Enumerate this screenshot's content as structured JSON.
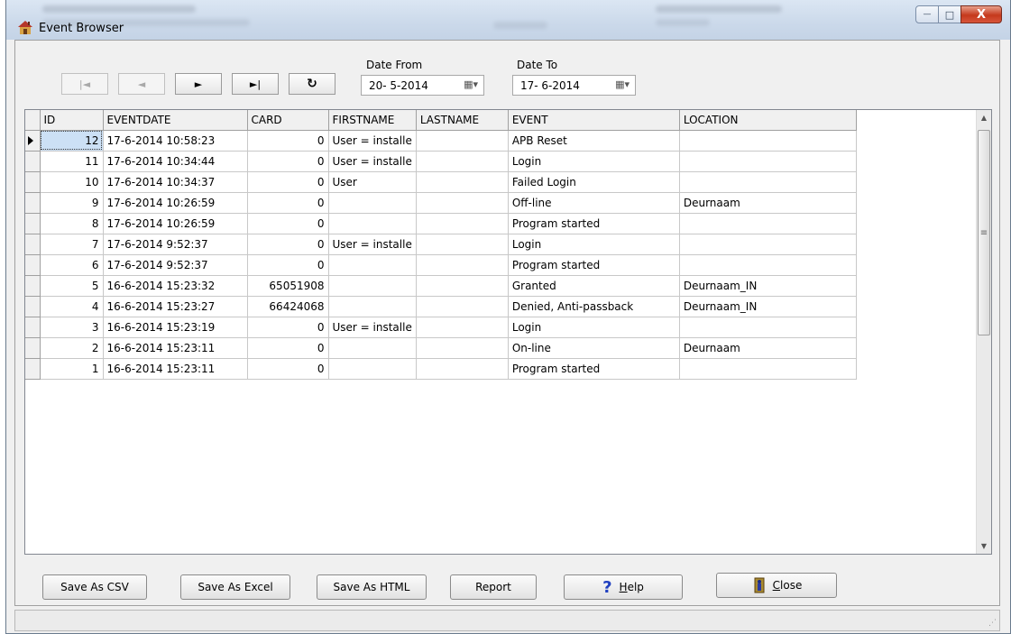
{
  "window": {
    "title": "Event Browser",
    "controls": {
      "minimize": "—",
      "maximize": "□",
      "close": "X"
    }
  },
  "toolbar": {
    "first": "|◄",
    "prior": "◄",
    "next": "►",
    "last": "►|",
    "refresh": "↻",
    "date_from_label": "Date From",
    "date_from_value": "20- 5-2014",
    "date_to_label": "Date To",
    "date_to_value": "17- 6-2014"
  },
  "grid": {
    "columns": [
      "ID",
      "EVENTDATE",
      "CARD",
      "FIRSTNAME",
      "LASTNAME",
      "EVENT",
      "LOCATION"
    ],
    "rows": [
      {
        "id": "12",
        "eventdate": "17-6-2014 10:58:23",
        "card": "0",
        "firstname": "User = installe",
        "lastname": "",
        "event": "APB Reset",
        "location": ""
      },
      {
        "id": "11",
        "eventdate": "17-6-2014 10:34:44",
        "card": "0",
        "firstname": "User = installe",
        "lastname": "",
        "event": "Login",
        "location": ""
      },
      {
        "id": "10",
        "eventdate": "17-6-2014 10:34:37",
        "card": "0",
        "firstname": "User",
        "lastname": "",
        "event": "Failed Login",
        "location": ""
      },
      {
        "id": "9",
        "eventdate": "17-6-2014 10:26:59",
        "card": "0",
        "firstname": "",
        "lastname": "",
        "event": "Off-line",
        "location": "Deurnaam"
      },
      {
        "id": "8",
        "eventdate": "17-6-2014 10:26:59",
        "card": "0",
        "firstname": "",
        "lastname": "",
        "event": "Program started",
        "location": ""
      },
      {
        "id": "7",
        "eventdate": "17-6-2014 9:52:37",
        "card": "0",
        "firstname": "User = installe",
        "lastname": "",
        "event": "Login",
        "location": ""
      },
      {
        "id": "6",
        "eventdate": "17-6-2014 9:52:37",
        "card": "0",
        "firstname": "",
        "lastname": "",
        "event": "Program started",
        "location": ""
      },
      {
        "id": "5",
        "eventdate": "16-6-2014 15:23:32",
        "card": "65051908",
        "firstname": "",
        "lastname": "",
        "event": "Granted",
        "location": "Deurnaam_IN"
      },
      {
        "id": "4",
        "eventdate": "16-6-2014 15:23:27",
        "card": "66424068",
        "firstname": "",
        "lastname": "",
        "event": "Denied, Anti-passback",
        "location": "Deurnaam_IN"
      },
      {
        "id": "3",
        "eventdate": "16-6-2014 15:23:19",
        "card": "0",
        "firstname": "User = installe",
        "lastname": "",
        "event": "Login",
        "location": ""
      },
      {
        "id": "2",
        "eventdate": "16-6-2014 15:23:11",
        "card": "0",
        "firstname": "",
        "lastname": "",
        "event": "On-line",
        "location": "Deurnaam"
      },
      {
        "id": "1",
        "eventdate": "16-6-2014 15:23:11",
        "card": "0",
        "firstname": "",
        "lastname": "",
        "event": "Program started",
        "location": ""
      }
    ]
  },
  "buttons": {
    "save_csv": "Save As CSV",
    "save_excel": "Save As Excel",
    "save_html": "Save As HTML",
    "report": "Report",
    "help_prefix": "",
    "help_hotkey": "H",
    "help_rest": "elp",
    "close_hotkey": "C",
    "close_rest": "lose"
  },
  "colors": {
    "selection": "#cce0f5",
    "help_icon": "#2040c0",
    "app_icon": "#b5372a"
  }
}
